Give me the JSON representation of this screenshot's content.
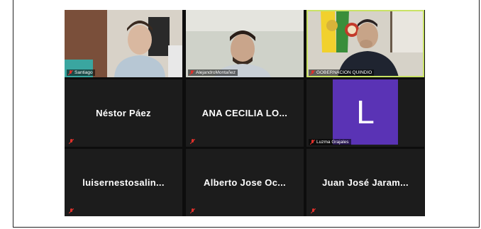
{
  "participants": [
    {
      "name": "Santiago",
      "display": "",
      "video": true
    },
    {
      "name": "AlejandroMontañez",
      "display": "",
      "video": true
    },
    {
      "name": "GOBERNACION QUINDIO",
      "display": "",
      "video": true,
      "active_speaker": true
    },
    {
      "name": "",
      "display": "Néstor Páez",
      "video": false
    },
    {
      "name": "",
      "display": "ANA CECILIA LO...",
      "video": false
    },
    {
      "name": "Luzma Grajales",
      "display": "",
      "video": false,
      "avatar_letter": "L"
    },
    {
      "name": "",
      "display": "luisernestosalin...",
      "video": false
    },
    {
      "name": "",
      "display": "Alberto Jose Oc...",
      "video": false
    },
    {
      "name": "",
      "display": "Juan José Jaram...",
      "video": false
    }
  ],
  "colors": {
    "grid_bg": "#0d0d0d",
    "tile_bg": "#1c1c1c",
    "active_speaker_border": "#c9e265",
    "avatar_bg": "#5a33b5",
    "muted_icon": "#e0312b"
  },
  "icons": {
    "muted": "mic-muted-icon"
  }
}
